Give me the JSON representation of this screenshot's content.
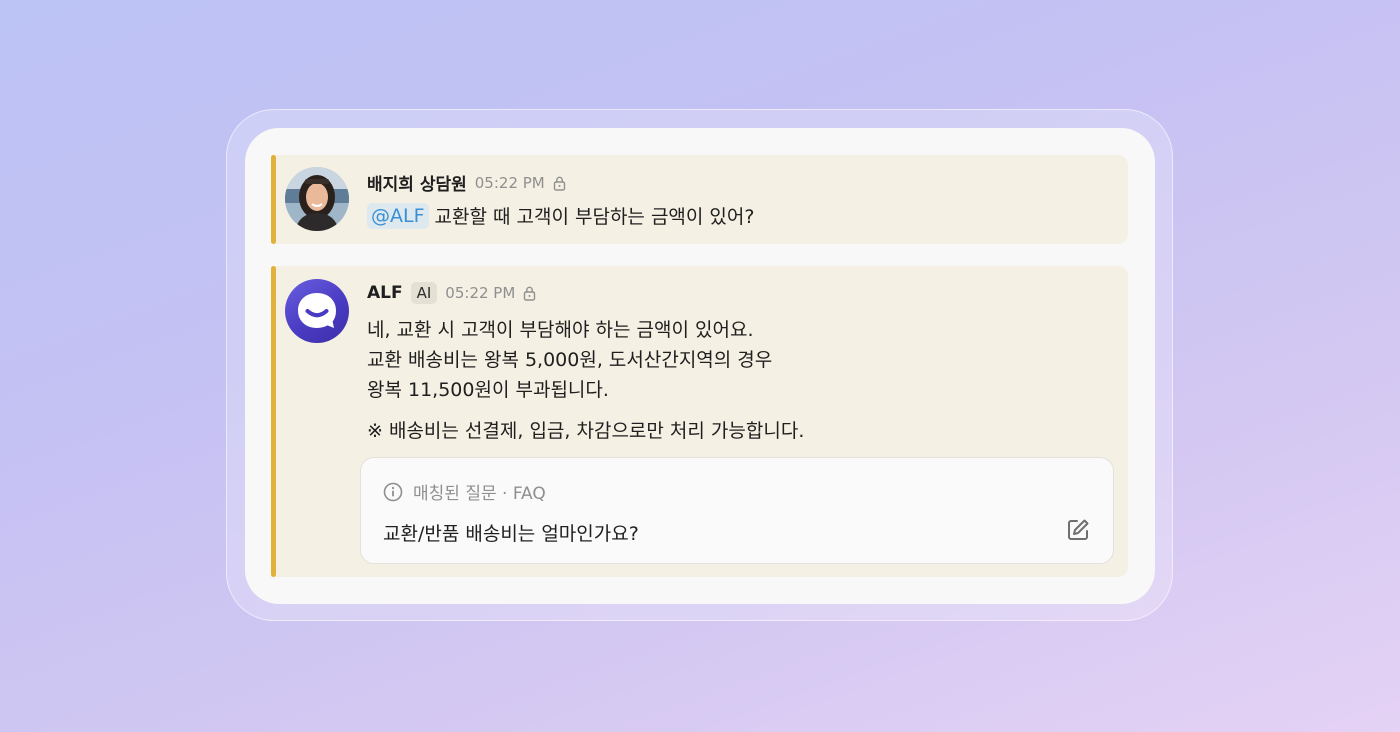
{
  "messages": [
    {
      "author": "배지희 상담원",
      "time": "05:22 PM",
      "mention": "@ALF",
      "text": "교환할 때 고객이 부담하는 금액이 있어?",
      "avatar_icon": "agent-photo"
    },
    {
      "author": "ALF",
      "badge": "AI",
      "time": "05:22 PM",
      "lines": [
        "네, 교환 시 고객이 부담해야 하는 금액이 있어요.",
        "교환 배송비는 왕복 5,000원, 도서산간지역의 경우",
        "왕복 11,500원이 부과됩니다."
      ],
      "note": "※ 배송비는 선결제, 입금, 차감으로만 처리 가능합니다.",
      "avatar_icon": "alf-logo",
      "faq": {
        "label": "매칭된 질문 · FAQ",
        "question": "교환/반품 배송비는 얼마인가요?",
        "icons": [
          "info-icon",
          "edit-icon"
        ]
      }
    }
  ],
  "colors": {
    "accent_bar": "#e1b23b",
    "message_bg": "#f4f0e3",
    "mention_text": "#3a8fd4",
    "alf_brand": "#5548d6"
  }
}
